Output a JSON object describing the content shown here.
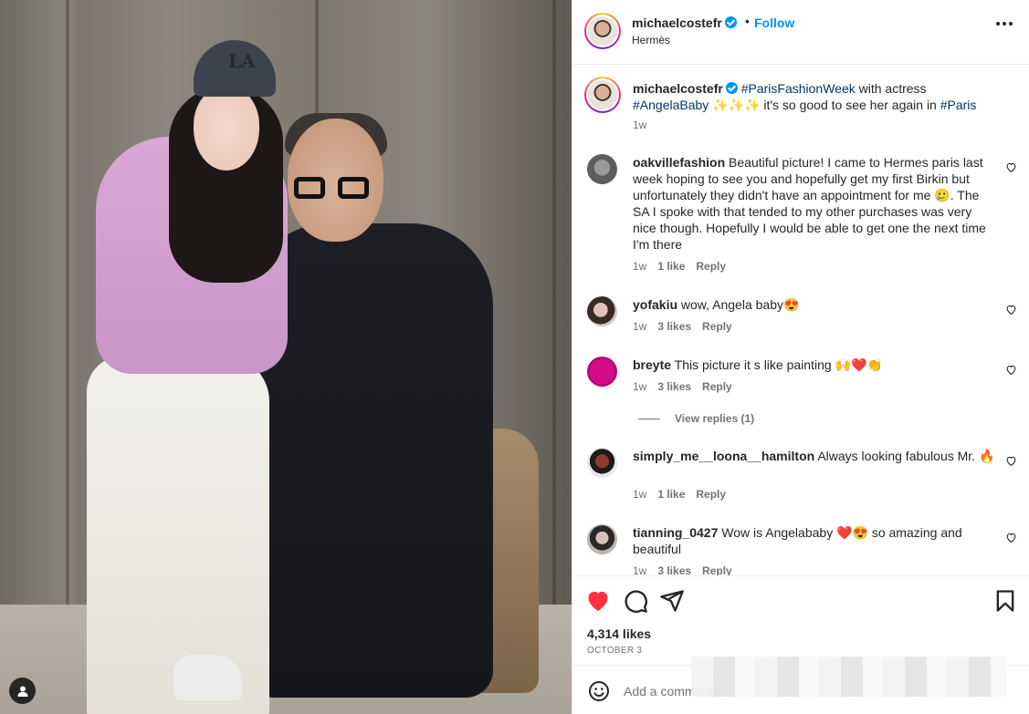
{
  "post": {
    "username": "michaelcostefr",
    "follow_label": "Follow",
    "separator": "•",
    "location": "Hermès",
    "caption": {
      "username": "michaelcostefr",
      "parts": [
        "#ParisFashionWeek",
        " with actress ",
        "#AngelaBaby",
        " ✨✨✨ it's so good to see her again in ",
        "#Paris"
      ],
      "time": "1w"
    }
  },
  "comments": [
    {
      "username": "oakvillefashion",
      "text": "Beautiful picture! I came to Hermes paris last week hoping to see you and hopefully get my first Birkin but unfortunately they didn't have an appointment for me 🥲. The SA I spoke with that tended to my other purchases was very nice though. Hopefully I would be able to get one the next time I'm there",
      "time": "1w",
      "likes": "1 like",
      "reply": "Reply"
    },
    {
      "username": "yofakiu",
      "text": "wow, Angela baby😍",
      "time": "1w",
      "likes": "3 likes",
      "reply": "Reply"
    },
    {
      "username": "breyte",
      "text": "This picture it s like painting 🙌❤️👏",
      "time": "1w",
      "likes": "3 likes",
      "reply": "Reply",
      "view_replies": "View replies (1)"
    },
    {
      "username": "simply_me__loona__hamilton",
      "text": "Always looking fabulous Mr. 🔥",
      "time": "1w",
      "likes": "1 like",
      "reply": "Reply"
    },
    {
      "username": "tianning_0427",
      "text": "Wow is Angelababy ❤️😍 so amazing and beautiful",
      "time": "1w",
      "likes": "3 likes",
      "reply": "Reply"
    }
  ],
  "stats": {
    "likes": "4,314 likes",
    "date": "OCTOBER 3"
  },
  "add_comment": {
    "placeholder": "Add a comment..."
  },
  "photo": {
    "cap_logo": "LA"
  },
  "colors": {
    "accent": "#0095f6",
    "heart": "#ff3040",
    "hashtag": "#00376b",
    "muted": "#737373"
  },
  "icons": {
    "like": "heart-filled-icon",
    "comment": "comment-bubble-icon",
    "share": "paper-plane-icon",
    "save": "bookmark-icon",
    "more": "more-horizontal-icon",
    "verified": "verified-badge-icon",
    "emoji": "emoji-icon",
    "tagged_user": "user-tag-icon"
  }
}
